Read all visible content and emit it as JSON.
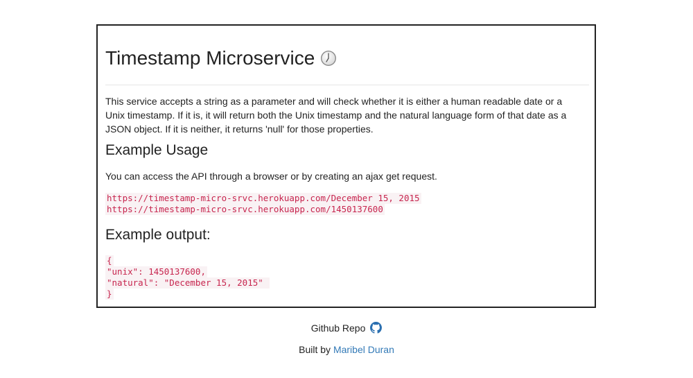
{
  "header": {
    "title": "Timestamp Microservice",
    "icon": "clock-icon"
  },
  "intro": {
    "description": "This service accepts a string as a parameter and will check whether it is either a human readable date or a Unix timestamp. If it is, it will return both the Unix timestamp and the natural language form of that date as a JSON object. If it is neither, it returns 'null' for those properties."
  },
  "usage": {
    "heading": "Example Usage",
    "text": "You can access the API through a browser or by creating an ajax get request.",
    "urls": [
      "https://timestamp-micro-srvc.herokuapp.com/December 15, 2015",
      "https://timestamp-micro-srvc.herokuapp.com/1450137600"
    ]
  },
  "output": {
    "heading": "Example output:",
    "lines": [
      "{",
      "\"unix\": 1450137600,",
      "\"natural\": \"December 15, 2015\" ",
      "}"
    ]
  },
  "footer": {
    "repo_label": "Github Repo",
    "repo_icon": "github-icon",
    "built_by_label": "Built by",
    "author_name": "Maribel Duran"
  },
  "colors": {
    "code_text": "#c7254e",
    "code_background": "#f9f2f4",
    "link": "#337ab7",
    "link_icon": "#2a6fb0"
  }
}
